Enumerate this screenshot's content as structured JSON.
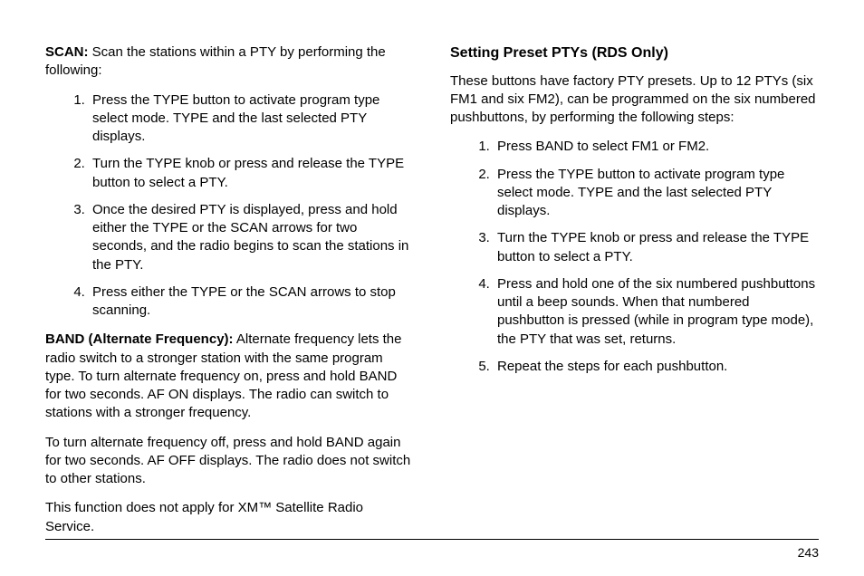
{
  "left": {
    "scanLead": "SCAN:",
    "scanText": "  Scan the stations within a PTY by performing the following:",
    "scanSteps": [
      "Press the TYPE button to activate program type select mode. TYPE and the last selected PTY displays.",
      "Turn the TYPE knob or press and release the TYPE button to select a PTY.",
      "Once the desired PTY is displayed, press and hold either the TYPE or the SCAN arrows for two seconds, and the radio begins to scan the stations in the PTY.",
      "Press either the TYPE or the SCAN arrows to stop scanning."
    ],
    "bandLead": "BAND (Alternate Frequency):",
    "bandText": "  Alternate frequency lets the radio switch to a stronger station with the same program type. To turn alternate frequency on, press and hold BAND for two seconds. AF ON displays. The radio can switch to stations with a stronger frequency.",
    "bandOff": "To turn alternate frequency off, press and hold BAND again for two seconds. AF OFF displays. The radio does not switch to other stations.",
    "bandNote": "This function does not apply for XM™ Satellite Radio Service."
  },
  "right": {
    "heading": "Setting Preset PTYs (RDS Only)",
    "intro": "These buttons have factory PTY presets. Up to 12 PTYs (six FM1 and six FM2), can be programmed on the six numbered pushbuttons, by performing the following steps:",
    "steps": [
      "Press BAND to select FM1 or FM2.",
      "Press the TYPE button to activate program type select mode. TYPE and the last selected PTY displays.",
      "Turn the TYPE knob or press and release the TYPE button to select a PTY.",
      "Press and hold one of the six numbered pushbuttons until a beep sounds. When that numbered pushbutton is pressed (while in program type mode), the PTY that was set, returns.",
      "Repeat the steps for each pushbutton."
    ]
  },
  "pageNumber": "243"
}
